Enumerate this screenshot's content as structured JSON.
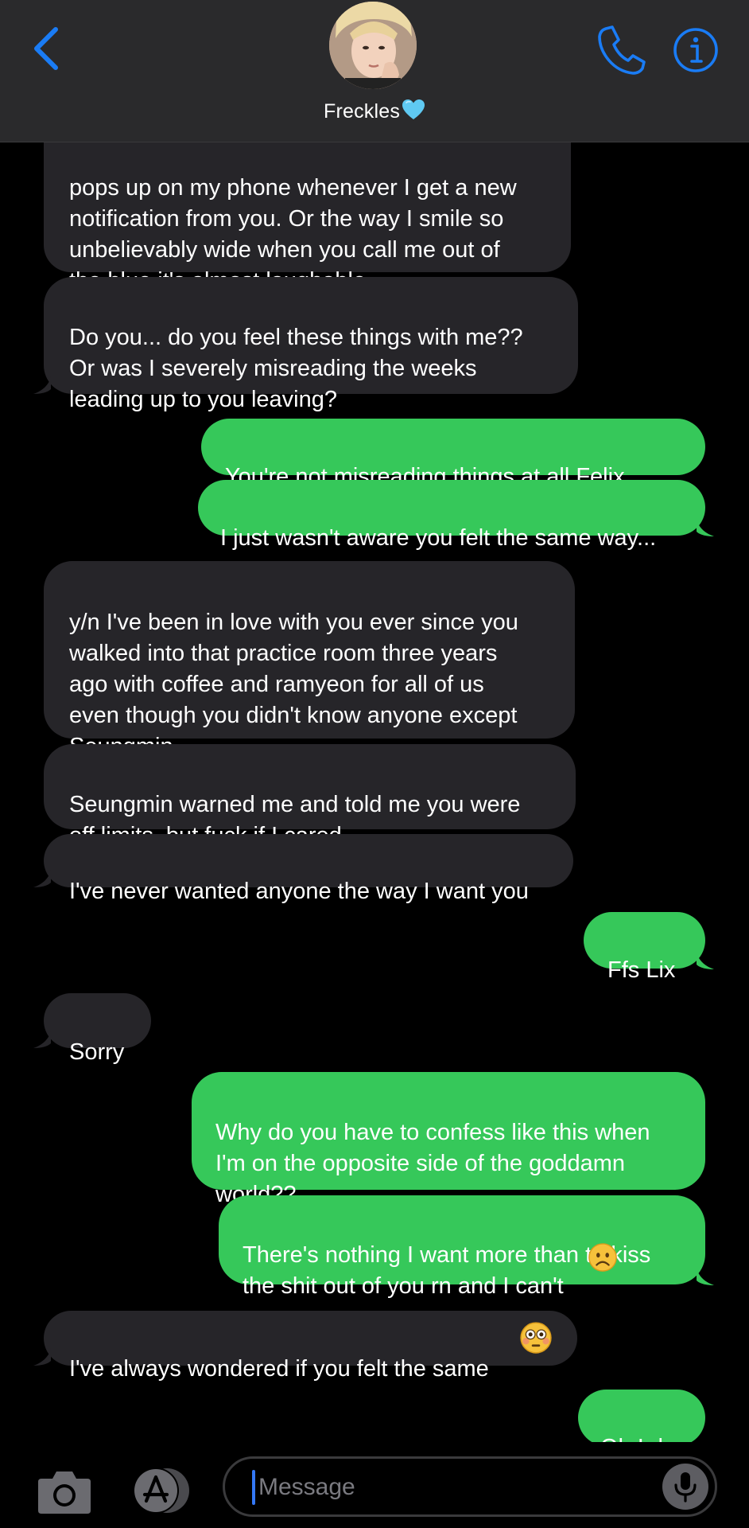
{
  "header": {
    "contact_name": "Freckles",
    "heart_emoji": "light-blue-heart",
    "back_icon": "chevron-left-icon",
    "call_icon": "phone-icon",
    "info_icon": "info-icon"
  },
  "colors": {
    "incoming_bubble": "#262529",
    "outgoing_bubble": "#36c85a",
    "accent": "#1a7cf5",
    "header_bg": "#2a2a2c"
  },
  "messages": [
    {
      "direction": "incoming",
      "text": "pops up on my phone whenever I get a new\nnotification from you. Or the way I smile so\nunbelievably wide when you call me out of\nthe blue it's almost laughable."
    },
    {
      "direction": "incoming",
      "text": "Do you... do you feel these things with me??\nOr was I severely misreading the weeks\nleading up to you leaving?"
    },
    {
      "direction": "outgoing",
      "text": "You're not misreading things at all Felix...."
    },
    {
      "direction": "outgoing",
      "text": "I just wasn't aware you felt the same way..."
    },
    {
      "direction": "incoming",
      "text": "y/n I've been in love with you ever since you\nwalked into that practice room three years\nago with coffee and ramyeon for all of us\neven though you didn't know anyone except\nSeungmin."
    },
    {
      "direction": "incoming",
      "text": "Seungmin warned me and told me you were\noff limits, but fuck if I cared."
    },
    {
      "direction": "incoming",
      "text": "I've never wanted anyone the way I want you"
    },
    {
      "direction": "outgoing",
      "text": "Ffs Lix"
    },
    {
      "direction": "incoming",
      "text": "Sorry"
    },
    {
      "direction": "outgoing",
      "text": "Why do you have to confess like this when\nI'm on the opposite side of the goddamn\nworld??"
    },
    {
      "direction": "outgoing",
      "text": "There's nothing I want more than to kiss\nthe shit out of you rn and I can't",
      "emoji": "frowning-face"
    },
    {
      "direction": "incoming",
      "text": "I've always wondered if you felt the same",
      "emoji": "flushed-face"
    },
    {
      "direction": "outgoing",
      "text": "Oh I do"
    }
  ],
  "composer": {
    "placeholder": "Message",
    "camera_icon": "camera-icon",
    "apps_icon": "app-store-icon",
    "mic_icon": "microphone-icon"
  }
}
